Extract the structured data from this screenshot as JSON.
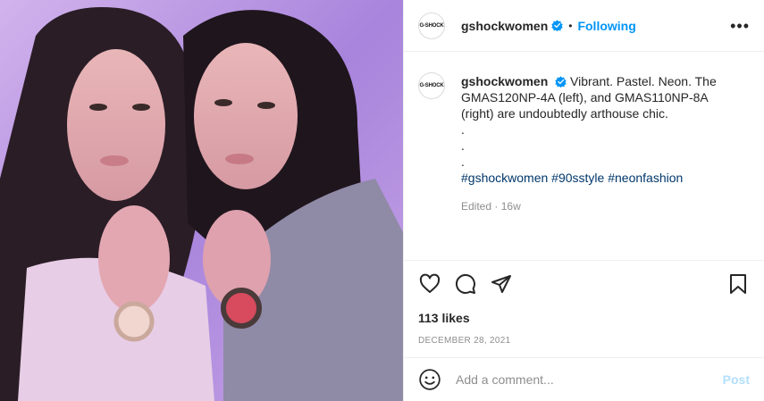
{
  "account": {
    "avatar_text": "G-SHOCK",
    "username": "gshockwomen",
    "verified_icon": "verified-badge-icon",
    "follow_state": "Following",
    "separator": "•"
  },
  "caption": {
    "username": "gshockwomen",
    "text": "Vibrant. Pastel. Neon. The GMAS120NP-4A (left), and GMAS110NP-8A (right) are undoubtedly arthouse chic.",
    "dots": [
      ".",
      ".",
      "."
    ],
    "hashtags": [
      "#gshockwomen",
      "#90sstyle",
      "#neonfashion"
    ],
    "edited": "Edited",
    "age": "16w"
  },
  "actions": {
    "icons": [
      "heart-icon",
      "comment-icon",
      "share-icon",
      "bookmark-icon"
    ],
    "likes": "113 likes",
    "date": "DECEMBER 28, 2021"
  },
  "comment_box": {
    "placeholder": "Add a comment...",
    "post_label": "Post"
  },
  "colors": {
    "accent": "#0095f6",
    "hashtag": "#00376b",
    "muted": "#8e8e8e",
    "post_disabled": "#b2dffc",
    "photo_bg": "#b58fe0"
  }
}
